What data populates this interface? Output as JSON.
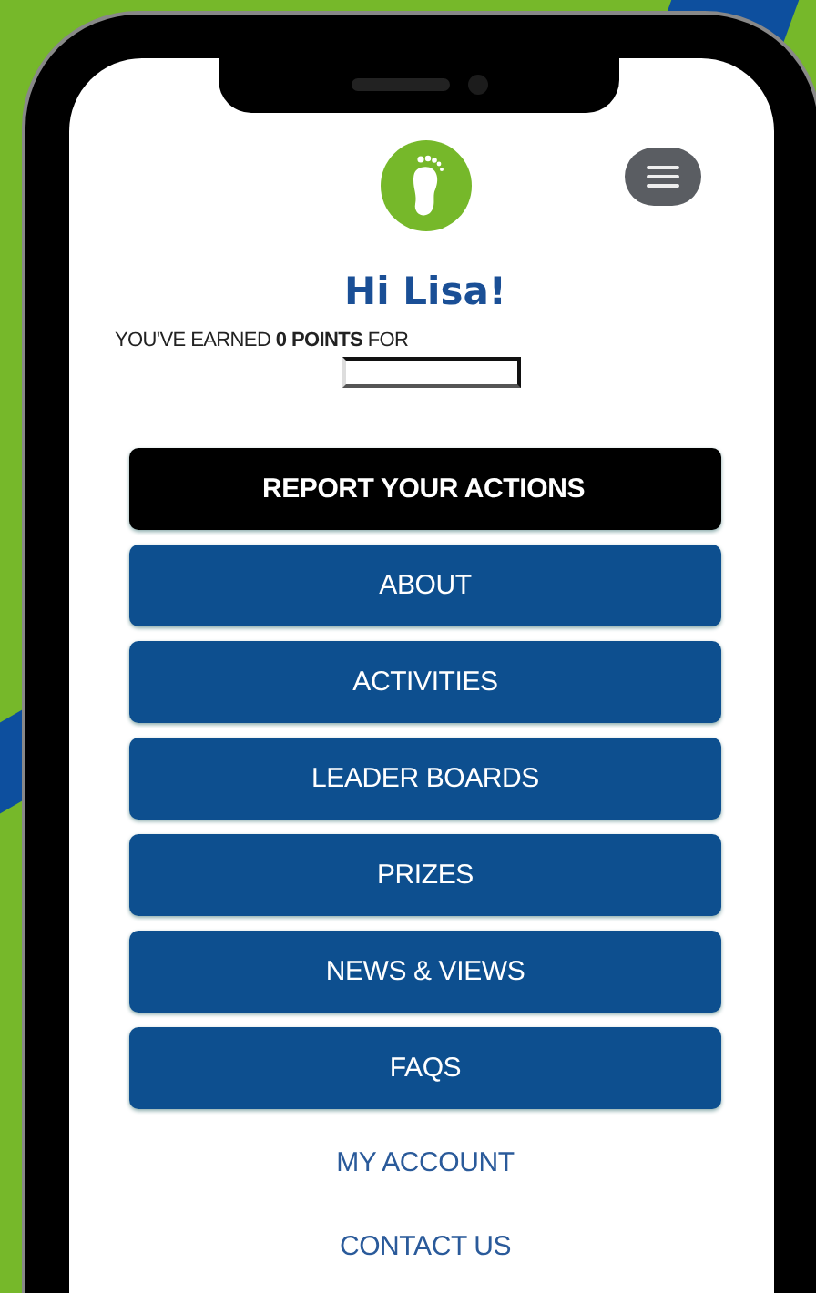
{
  "greeting": "Hi Lisa!",
  "earned_text": "YOU'VE EARNED **0 POINTS** FOR",
  "menu_buttons": [
    {
      "label": "REPORT YOUR ACTIONS",
      "kind": "highlight"
    },
    {
      "label": "ABOUT",
      "kind": "default"
    },
    {
      "label": "ACTIVITIES",
      "kind": "default"
    },
    {
      "label": "LEADER BOARDS",
      "kind": "default"
    },
    {
      "label": "PRIZES",
      "kind": "default"
    },
    {
      "label": "NEWS & VIEWS",
      "kind": "default"
    },
    {
      "label": "FAQS",
      "kind": "default"
    }
  ],
  "links": [
    "MY ACCOUNT",
    "CONTACT US"
  ]
}
